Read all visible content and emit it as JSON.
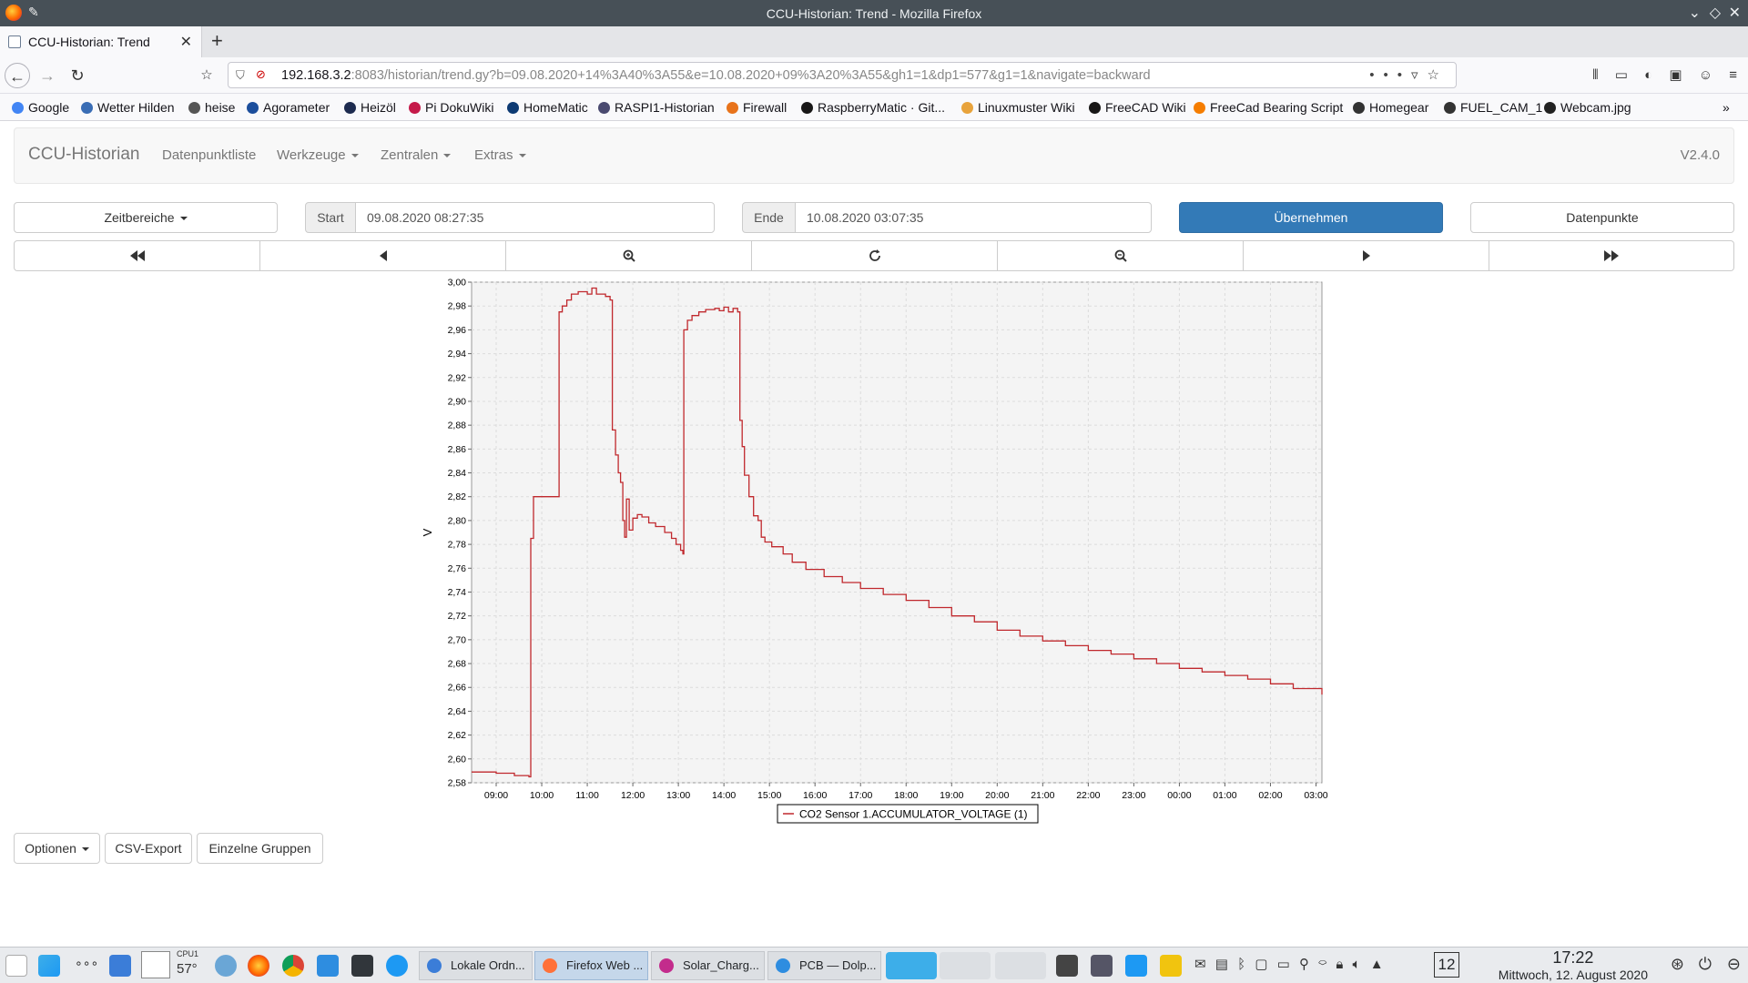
{
  "window": {
    "title": "CCU-Historian: Trend - Mozilla Firefox"
  },
  "browser": {
    "tab_title": "CCU-Historian: Trend",
    "url_host": "192.168.3.2",
    "url_rest": ":8083/historian/trend.gy?b=09.08.2020+14%3A40%3A55&e=10.08.2020+09%3A20%3A55&gh1=1&dp1=577&g1=1&navigate=backward",
    "bookmarks": [
      {
        "label": "Google",
        "color": "#4285f4"
      },
      {
        "label": "Wetter Hilden",
        "color": "#3a6db5"
      },
      {
        "label": "heise",
        "color": "#555555"
      },
      {
        "label": "Agorameter",
        "color": "#1c4e9c"
      },
      {
        "label": "Heizöl",
        "color": "#1d2b4f"
      },
      {
        "label": "Pi DokuWiki",
        "color": "#c51a4a"
      },
      {
        "label": "HomeMatic",
        "color": "#0d3a73"
      },
      {
        "label": "RASPI1-Historian",
        "color": "#4a4a70"
      },
      {
        "label": "Firewall",
        "color": "#e8731b"
      },
      {
        "label": "RaspberryMatic · Git...",
        "color": "#181717"
      },
      {
        "label": "Linuxmuster Wiki",
        "color": "#e8a33c"
      },
      {
        "label": "FreeCAD Wiki",
        "color": "#181717"
      },
      {
        "label": "FreeCad Bearing Script",
        "color": "#f57d00"
      },
      {
        "label": "Homegear",
        "color": "#333333"
      },
      {
        "label": "FUEL_CAM_1",
        "color": "#333333"
      },
      {
        "label": "Webcam.jpg",
        "color": "#222222"
      }
    ]
  },
  "app": {
    "brand": "CCU-Historian",
    "menu": {
      "datenpunktliste": "Datenpunktliste",
      "werkzeuge": "Werkzeuge",
      "zentralen": "Zentralen",
      "extras": "Extras"
    },
    "version": "V2.4.0"
  },
  "controls": {
    "zeitbereiche": "Zeitbereiche",
    "start_label": "Start",
    "start_value": "09.08.2020 08:27:35",
    "ende_label": "Ende",
    "ende_value": "10.08.2020 03:07:35",
    "apply": "Übernehmen",
    "datenpunkte": "Datenpunkte"
  },
  "bottom_buttons": {
    "optionen": "Optionen",
    "csv_export": "CSV-Export",
    "einzelne_gruppen": "Einzelne Gruppen"
  },
  "colors": {
    "primary": "#337ab7",
    "series": "#c0282d",
    "plot_bg": "#f4f4f4"
  },
  "chart_data": {
    "type": "line",
    "ylabel": "V",
    "ylim": [
      2.58,
      3.0
    ],
    "y_ticks": [
      "2,58",
      "2,60",
      "2,62",
      "2,64",
      "2,66",
      "2,68",
      "2,70",
      "2,72",
      "2,74",
      "2,76",
      "2,78",
      "2,80",
      "2,82",
      "2,84",
      "2,86",
      "2,88",
      "2,90",
      "2,92",
      "2,94",
      "2,96",
      "2,98",
      "3,00"
    ],
    "x_range_hours": [
      8.46,
      27.13
    ],
    "x_ticks": [
      {
        "label": "09:00",
        "hour": 9
      },
      {
        "label": "10:00",
        "hour": 10
      },
      {
        "label": "11:00",
        "hour": 11
      },
      {
        "label": "12:00",
        "hour": 12
      },
      {
        "label": "13:00",
        "hour": 13
      },
      {
        "label": "14:00",
        "hour": 14
      },
      {
        "label": "15:00",
        "hour": 15
      },
      {
        "label": "16:00",
        "hour": 16
      },
      {
        "label": "17:00",
        "hour": 17
      },
      {
        "label": "18:00",
        "hour": 18
      },
      {
        "label": "19:00",
        "hour": 19
      },
      {
        "label": "20:00",
        "hour": 20
      },
      {
        "label": "21:00",
        "hour": 21
      },
      {
        "label": "22:00",
        "hour": 22
      },
      {
        "label": "23:00",
        "hour": 23
      },
      {
        "label": "00:00",
        "hour": 24
      },
      {
        "label": "01:00",
        "hour": 25
      },
      {
        "label": "02:00",
        "hour": 26
      },
      {
        "label": "03:00",
        "hour": 27
      }
    ],
    "series": [
      {
        "name": "CO2 Sensor 1.ACCUMULATOR_VOLTAGE (1)",
        "step": true,
        "points": [
          [
            8.46,
            2.589
          ],
          [
            9.0,
            2.588
          ],
          [
            9.4,
            2.586
          ],
          [
            9.72,
            2.585
          ],
          [
            9.76,
            2.785
          ],
          [
            9.82,
            2.82
          ],
          [
            10.33,
            2.82
          ],
          [
            10.38,
            2.975
          ],
          [
            10.45,
            2.98
          ],
          [
            10.55,
            2.985
          ],
          [
            10.65,
            2.99
          ],
          [
            10.8,
            2.992
          ],
          [
            11.0,
            2.99
          ],
          [
            11.1,
            2.995
          ],
          [
            11.2,
            2.99
          ],
          [
            11.4,
            2.988
          ],
          [
            11.5,
            2.985
          ],
          [
            11.55,
            2.876
          ],
          [
            11.62,
            2.855
          ],
          [
            11.68,
            2.84
          ],
          [
            11.73,
            2.832
          ],
          [
            11.78,
            2.8
          ],
          [
            11.82,
            2.786
          ],
          [
            11.86,
            2.818
          ],
          [
            11.92,
            2.792
          ],
          [
            12.0,
            2.802
          ],
          [
            12.1,
            2.805
          ],
          [
            12.2,
            2.803
          ],
          [
            12.35,
            2.798
          ],
          [
            12.5,
            2.795
          ],
          [
            12.7,
            2.79
          ],
          [
            12.85,
            2.785
          ],
          [
            12.95,
            2.78
          ],
          [
            13.05,
            2.775
          ],
          [
            13.1,
            2.772
          ],
          [
            13.12,
            2.96
          ],
          [
            13.2,
            2.968
          ],
          [
            13.3,
            2.972
          ],
          [
            13.45,
            2.975
          ],
          [
            13.6,
            2.977
          ],
          [
            13.8,
            2.978
          ],
          [
            13.9,
            2.976
          ],
          [
            14.0,
            2.979
          ],
          [
            14.1,
            2.975
          ],
          [
            14.2,
            2.978
          ],
          [
            14.3,
            2.975
          ],
          [
            14.35,
            2.884
          ],
          [
            14.4,
            2.862
          ],
          [
            14.45,
            2.838
          ],
          [
            14.55,
            2.82
          ],
          [
            14.65,
            2.804
          ],
          [
            14.75,
            2.8
          ],
          [
            14.82,
            2.786
          ],
          [
            14.9,
            2.782
          ],
          [
            15.05,
            2.778
          ],
          [
            15.3,
            2.772
          ],
          [
            15.5,
            2.765
          ],
          [
            15.8,
            2.759
          ],
          [
            16.2,
            2.753
          ],
          [
            16.6,
            2.748
          ],
          [
            17.0,
            2.743
          ],
          [
            17.5,
            2.738
          ],
          [
            18.0,
            2.733
          ],
          [
            18.5,
            2.727
          ],
          [
            19.0,
            2.72
          ],
          [
            19.5,
            2.715
          ],
          [
            20.0,
            2.708
          ],
          [
            20.5,
            2.703
          ],
          [
            21.0,
            2.699
          ],
          [
            21.5,
            2.695
          ],
          [
            22.0,
            2.691
          ],
          [
            22.5,
            2.688
          ],
          [
            23.0,
            2.684
          ],
          [
            23.5,
            2.68
          ],
          [
            24.0,
            2.676
          ],
          [
            24.5,
            2.673
          ],
          [
            25.0,
            2.67
          ],
          [
            25.5,
            2.667
          ],
          [
            26.0,
            2.663
          ],
          [
            26.5,
            2.659
          ],
          [
            27.13,
            2.654
          ]
        ]
      }
    ]
  },
  "taskbar": {
    "cpu_label": "CPU1",
    "cpu_temp": "57°",
    "tasks": [
      {
        "label": "Lokale Ordn...",
        "color": "#3b7dd8",
        "active": false
      },
      {
        "label": "Firefox Web ...",
        "color": "#ff7139",
        "active": true
      },
      {
        "label": "Solar_Charg...",
        "color": "#c32c8c",
        "active": false
      },
      {
        "label": "PCB — Dolp...",
        "color": "#2e8de0",
        "active": false
      }
    ],
    "time": "17:22",
    "date": "Mittwoch, 12. August 2020",
    "calendar_day": "12"
  }
}
